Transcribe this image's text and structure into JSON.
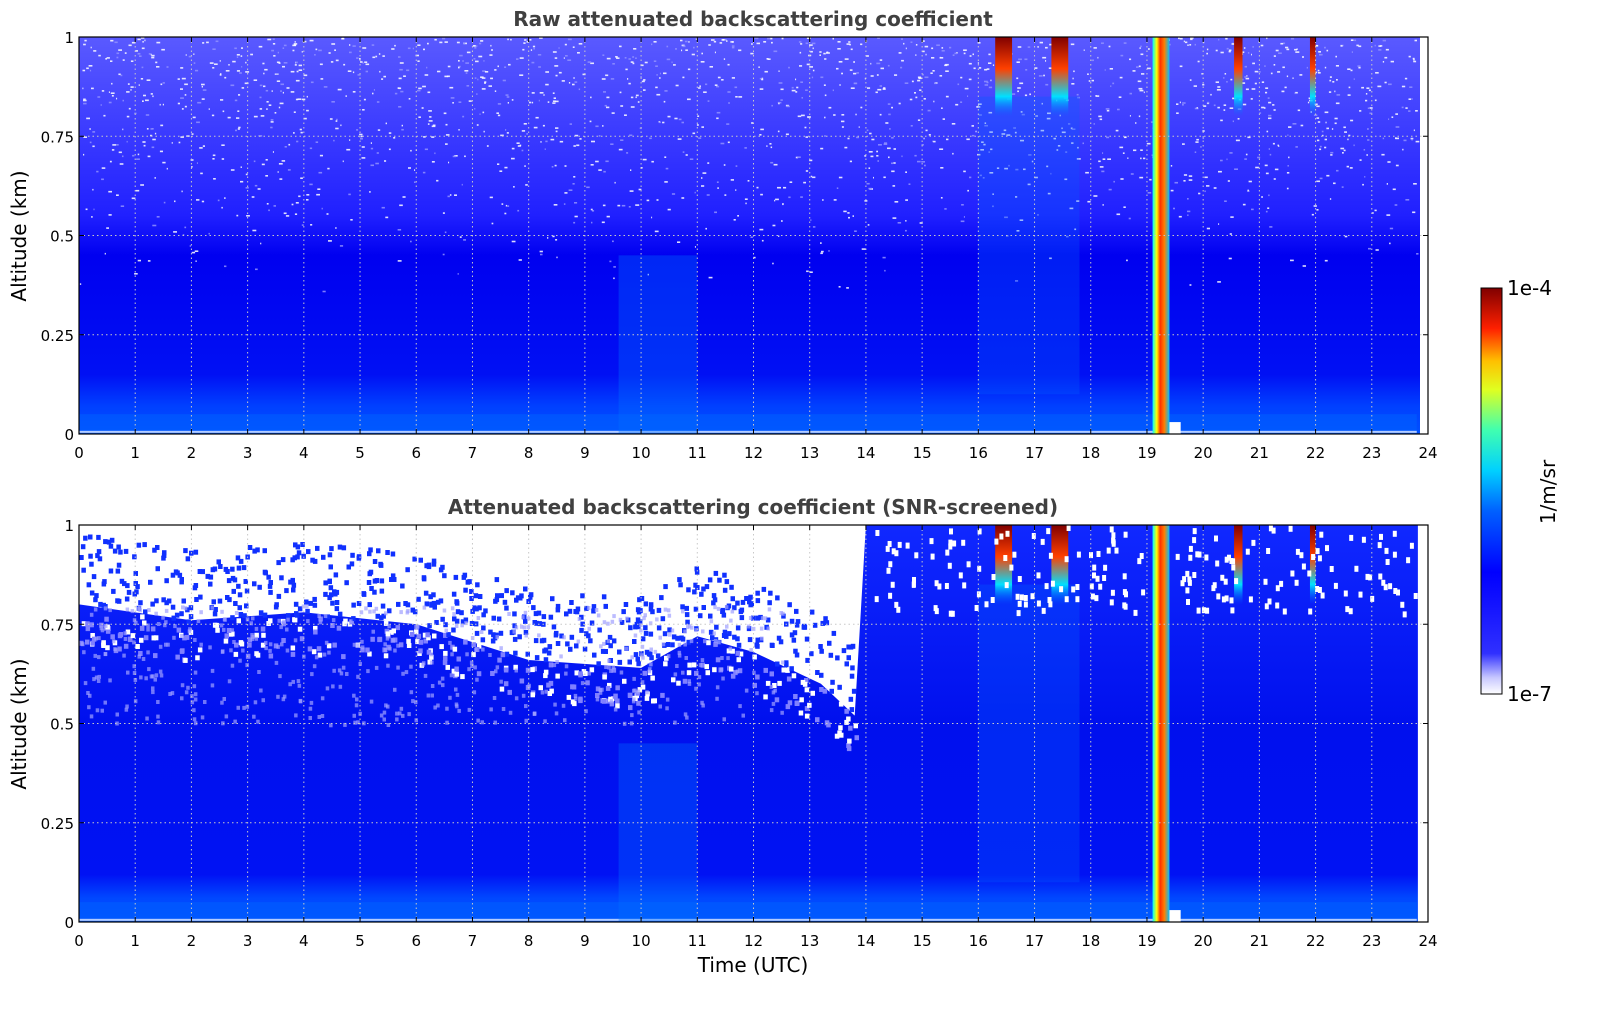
{
  "chart_data": [
    {
      "type": "heatmap",
      "title": "Raw attenuated backscattering coefficient",
      "xlabel": "",
      "ylabel": "Altitude (km)",
      "xlim": [
        0,
        24
      ],
      "ylim": [
        0,
        1
      ],
      "x_ticks": [
        "0",
        "1",
        "2",
        "3",
        "4",
        "5",
        "6",
        "7",
        "8",
        "9",
        "10",
        "11",
        "12",
        "13",
        "14",
        "15",
        "16",
        "17",
        "18",
        "19",
        "20",
        "21",
        "22",
        "23",
        "24"
      ],
      "y_ticks": [
        "0",
        "0.25",
        "0.5",
        "0.75",
        "1"
      ],
      "grid": true,
      "colorscale": "jet",
      "screened": false,
      "features": [
        {
          "x_range": [
            19.1,
            19.4
          ],
          "y_range": [
            0,
            1
          ],
          "value": "high (~5e-5 to 1e-4)"
        },
        {
          "x_range": [
            16.3,
            16.6
          ],
          "y_range": [
            0.8,
            1
          ],
          "value": "high"
        },
        {
          "x_range": [
            17.3,
            17.6
          ],
          "y_range": [
            0.8,
            1
          ],
          "value": "high"
        },
        {
          "x_range": [
            0,
            24
          ],
          "y_range": [
            0,
            0.05
          ],
          "value": "elevated near surface"
        }
      ]
    },
    {
      "type": "heatmap",
      "title": "Attenuated backscattering coefficient (SNR-screened)",
      "xlabel": "Time (UTC)",
      "ylabel": "Altitude (km)",
      "xlim": [
        0,
        24
      ],
      "ylim": [
        0,
        1
      ],
      "x_ticks": [
        "0",
        "1",
        "2",
        "3",
        "4",
        "5",
        "6",
        "7",
        "8",
        "9",
        "10",
        "11",
        "12",
        "13",
        "14",
        "15",
        "16",
        "17",
        "18",
        "19",
        "20",
        "21",
        "22",
        "23",
        "24"
      ],
      "y_ticks": [
        "0",
        "0.25",
        "0.5",
        "0.75",
        "1"
      ],
      "grid": true,
      "colorscale": "jet",
      "screened": true,
      "screened_top_km": [
        {
          "x": 0,
          "y": 0.8
        },
        {
          "x": 2,
          "y": 0.76
        },
        {
          "x": 4,
          "y": 0.78
        },
        {
          "x": 6,
          "y": 0.75
        },
        {
          "x": 8,
          "y": 0.66
        },
        {
          "x": 10,
          "y": 0.64
        },
        {
          "x": 11,
          "y": 0.72
        },
        {
          "x": 12,
          "y": 0.68
        },
        {
          "x": 13.2,
          "y": 0.6
        },
        {
          "x": 13.8,
          "y": 0.52
        },
        {
          "x": 14,
          "y": 1.0
        },
        {
          "x": 24,
          "y": 1.0
        }
      ]
    }
  ],
  "colorbar": {
    "max_label": "1e-4",
    "min_label": "1e-7",
    "unit_label": "1/m/sr",
    "scale": "log",
    "colors": [
      "#ffffff",
      "#0000ff",
      "#00ffff",
      "#ffff00",
      "#ff0000",
      "#800000"
    ]
  }
}
